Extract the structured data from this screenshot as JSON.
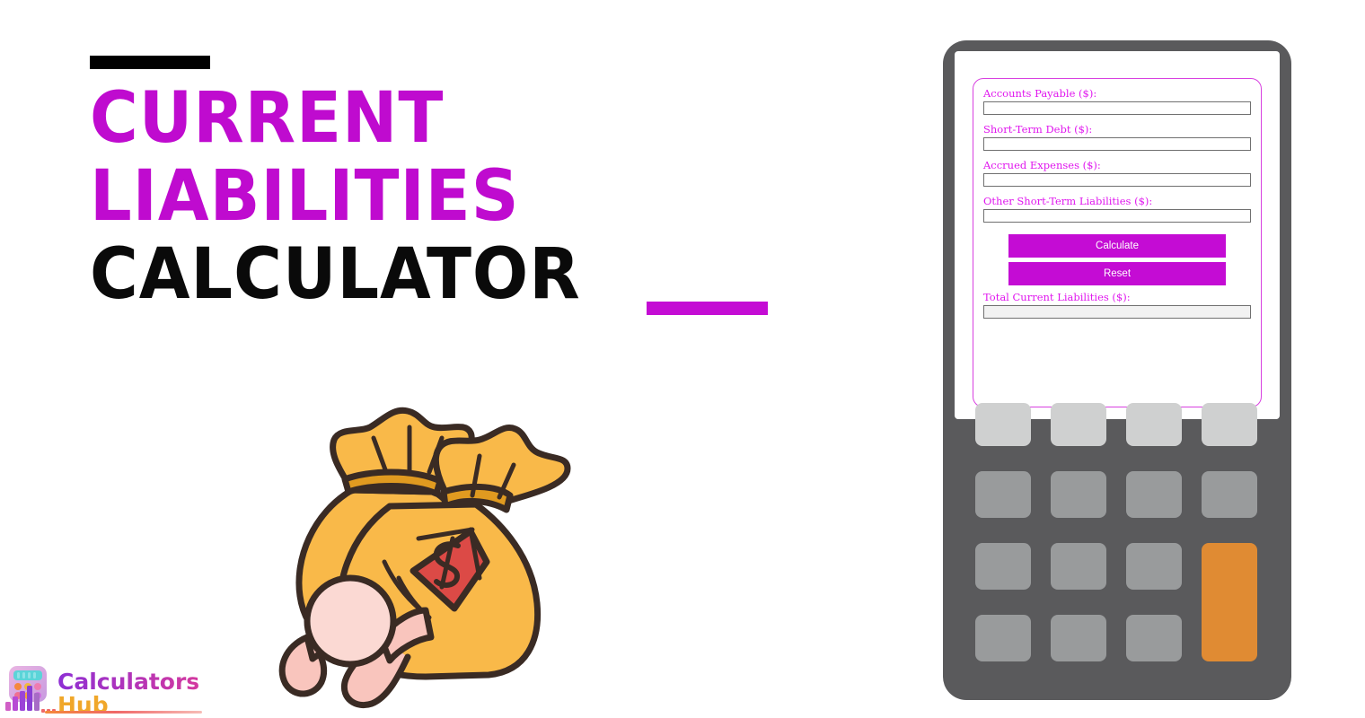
{
  "page": {
    "background_color": "#ffffff",
    "accent_magenta": "#c40cd4",
    "accent_black": "#0a0a0a",
    "accent_orange": "#e08b33"
  },
  "title": {
    "line1": "CURRENT",
    "line2": "LIABILITIES",
    "line3": "CALCULATOR",
    "top_rule_color": "#000000",
    "bottom_rule_color": "#c40cd4"
  },
  "logo": {
    "name_part1": "Calculators",
    "name_part2": "Hub",
    "part1_color": "#b02ad6",
    "part2_color": "#f0a72a",
    "icon": "calculator-bars-icon"
  },
  "illustration": {
    "name": "money-bags-crushing-person-illustration",
    "bag_color": "#f9b949",
    "bag_tie_color": "#e09a20",
    "outline_color": "#3a2b24",
    "tag_color": "#dc4a46",
    "tag_symbol": "$",
    "person_color": "#f9c5bd",
    "person_head_color": "#fbd9d3"
  },
  "calculator": {
    "body_color": "#5a5a5c",
    "screen_color": "#ffffff",
    "form": {
      "border_color": "#d840e0",
      "fields": [
        {
          "label": "Accounts Payable ($):",
          "value": "",
          "placeholder": ""
        },
        {
          "label": "Short-Term Debt ($):",
          "value": "",
          "placeholder": ""
        },
        {
          "label": "Accrued Expenses ($):",
          "value": "",
          "placeholder": ""
        },
        {
          "label": "Other Short-Term Liabilities ($):",
          "value": "",
          "placeholder": ""
        }
      ],
      "buttons": [
        {
          "label": "Calculate",
          "color": "#c40cd4"
        },
        {
          "label": "Reset",
          "color": "#c40cd4"
        }
      ],
      "result": {
        "label": "Total Current Liabilities ($):",
        "value": "",
        "placeholder": ""
      }
    },
    "keypad": {
      "rows": [
        {
          "style": "light",
          "keys": 4
        },
        {
          "style": "dark",
          "keys": 4
        },
        {
          "style": "dark",
          "keys": 3
        },
        {
          "style": "dark",
          "keys": 3
        }
      ],
      "accent_key": {
        "style": "accent",
        "span_rows": 2
      },
      "light_color": "#cfd0d0",
      "dark_color": "#999b9c",
      "accent_color": "#e08b33"
    }
  }
}
